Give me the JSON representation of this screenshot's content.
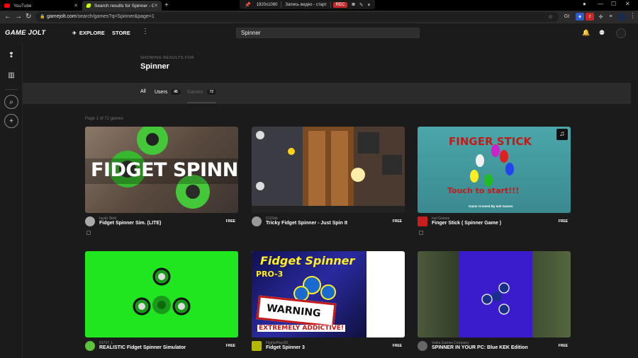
{
  "browser": {
    "tabs": [
      {
        "title": "YouTube",
        "active": false
      },
      {
        "title": "Search results for Spinner - Gam",
        "active": true
      }
    ],
    "new_tab": "+",
    "url_host": "gamejolt.com",
    "url_path": "/search/games?q=Spinner&page=1",
    "recorder": {
      "resolution": "1920x1080",
      "title": "Запись видео - старт",
      "rec_label": "REC"
    },
    "ext_badges": {
      "translate": "Gt",
      "red": "2"
    }
  },
  "gamejolt": {
    "logo": "GAME JOLT",
    "nav": {
      "explore": "EXPLORE",
      "store": "STORE"
    },
    "search_value": "Spinner"
  },
  "results": {
    "showing_label": "SHOWING RESULTS FOR",
    "query": "Spinner",
    "tabs": [
      {
        "label": "All",
        "count": ""
      },
      {
        "label": "Users",
        "count": "45"
      },
      {
        "label": "Games",
        "count": "72"
      }
    ],
    "page_info": "Page 1 of 72 games",
    "games": [
      {
        "developer": "Iaydn Strid",
        "title": "Fidget Spinner Sim. (LITE)",
        "price": "FREE",
        "thumb_text": "FIDGET SPINNER",
        "bg": "#6d5a4c"
      },
      {
        "developer": "0123ob",
        "title": "Tricky Fidget Spinner - Just Spin It",
        "price": "FREE",
        "thumb_text": "",
        "bg": "#3b2f24"
      },
      {
        "developer": "Isel Games",
        "title": "Finger Stick ( Spinner Game )",
        "price": "FREE",
        "thumb_text": "FINGER STICK",
        "thumb_sub": "Touch to start!!!",
        "thumb_credit": "Game Created By Isel Games",
        "bg": "#3f8f94"
      },
      {
        "developer": "01737_L",
        "title": "REALISTIC Fidget Spinner Simulator",
        "price": "FREE",
        "thumb_text": "",
        "bg": "#1fe61f"
      },
      {
        "developer": "FlightsPlaySD",
        "title": "Fidget Spinner 3",
        "price": "FREE",
        "thumb_text": "Fidget Spinner",
        "thumb_sub": "PRO-3",
        "thumb_warn": "WARNING",
        "thumb_warn2": "EXTREMELY ADDICTIVE!",
        "bg": "#1a1a6e"
      },
      {
        "developer": "Valira Games Company",
        "title": "SPINNER IN YOUR PC: Blue KEK Edition",
        "price": "FREE",
        "thumb_text": "",
        "bg": "#3a4a2c"
      }
    ]
  },
  "colors": {
    "accent": "#ccff00",
    "bg": "#1b1b1b",
    "panel": "#2b2b2b"
  }
}
